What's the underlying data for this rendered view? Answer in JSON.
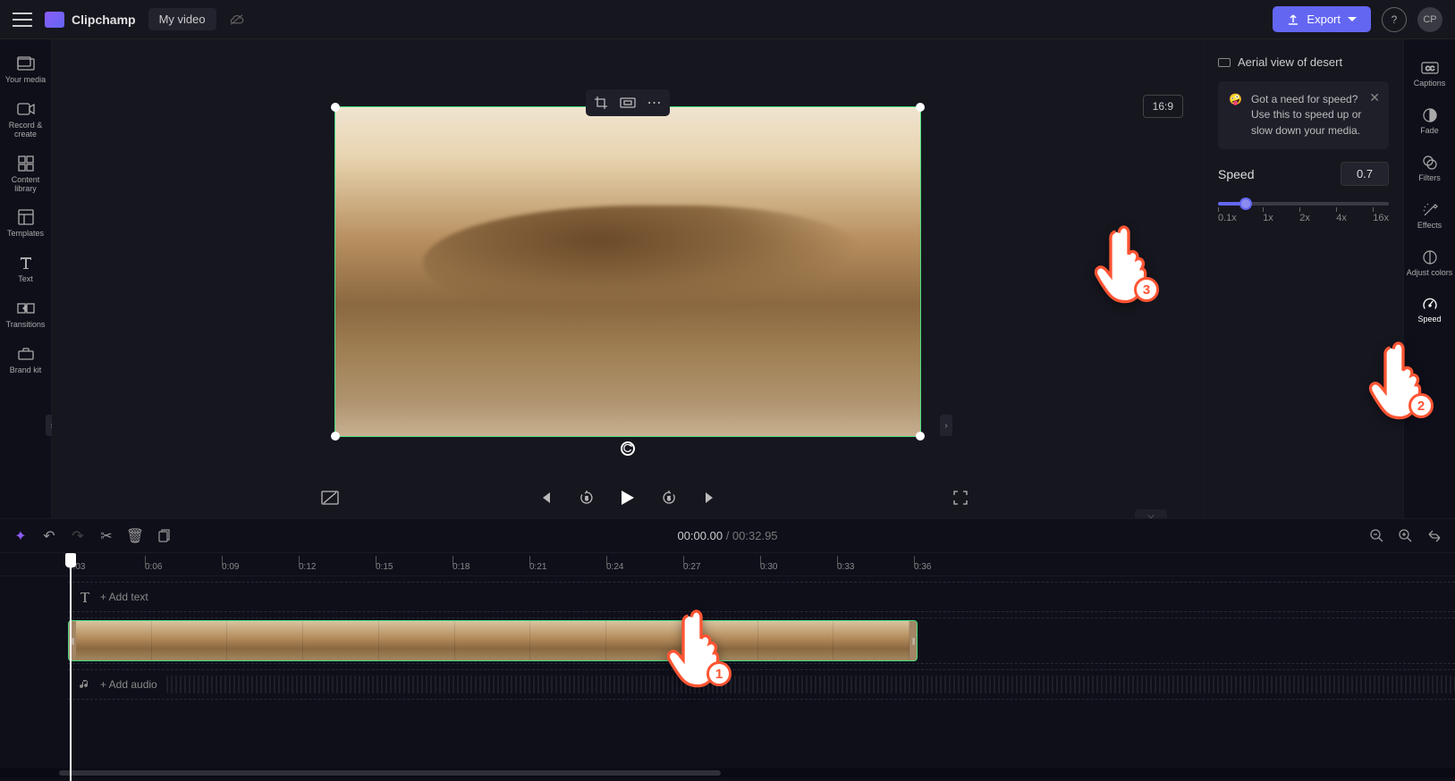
{
  "topbar": {
    "app_name": "Clipchamp",
    "video_title": "My video",
    "export_label": "Export",
    "avatar_initials": "CP"
  },
  "sidebar_left": {
    "items": [
      {
        "label": "Your media"
      },
      {
        "label": "Record & create"
      },
      {
        "label": "Content library"
      },
      {
        "label": "Templates"
      },
      {
        "label": "Text"
      },
      {
        "label": "Transitions"
      },
      {
        "label": "Brand kit"
      }
    ]
  },
  "canvas": {
    "aspect": "16:9"
  },
  "playback": {
    "current_time": "00:00.00",
    "separator": " / ",
    "duration": "00:32.95"
  },
  "panel": {
    "clip_name": "Aerial view of desert",
    "tip_emoji": "🤪",
    "tip_text": "Got a need for speed? Use this to speed up or slow down your media.",
    "speed_label": "Speed",
    "speed_value": "0.7",
    "ticks": [
      "0.1x",
      "1x",
      "2x",
      "4x",
      "16x"
    ]
  },
  "rail_right": {
    "items": [
      {
        "label": "Captions"
      },
      {
        "label": "Fade"
      },
      {
        "label": "Filters"
      },
      {
        "label": "Effects"
      },
      {
        "label": "Adjust colors"
      },
      {
        "label": "Speed"
      }
    ]
  },
  "timeline": {
    "ruler_zero": "0",
    "marks": [
      "0:03",
      "0:06",
      "0:09",
      "0:12",
      "0:15",
      "0:18",
      "0:21",
      "0:24",
      "0:27",
      "0:30",
      "0:33",
      "0:36"
    ],
    "add_text_label": "+ Add text",
    "add_audio_label": "+ Add audio"
  },
  "annotations": {
    "hand1": "1",
    "hand2": "2",
    "hand3": "3"
  }
}
